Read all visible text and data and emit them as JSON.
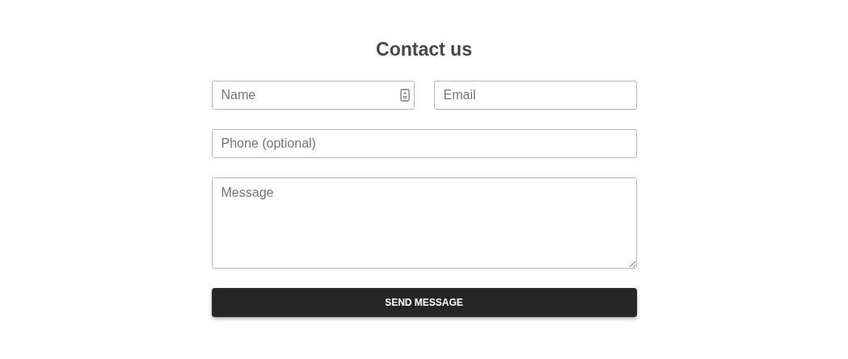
{
  "title": "Contact us",
  "fields": [
    {
      "kind": "text",
      "placeholder": "Name",
      "autofill_icon": true
    },
    {
      "kind": "text",
      "placeholder": "Email"
    },
    {
      "kind": "text",
      "placeholder": "Phone (optional)"
    },
    {
      "kind": "textarea",
      "placeholder": "Message"
    }
  ],
  "button": "SEND MESSAGE"
}
